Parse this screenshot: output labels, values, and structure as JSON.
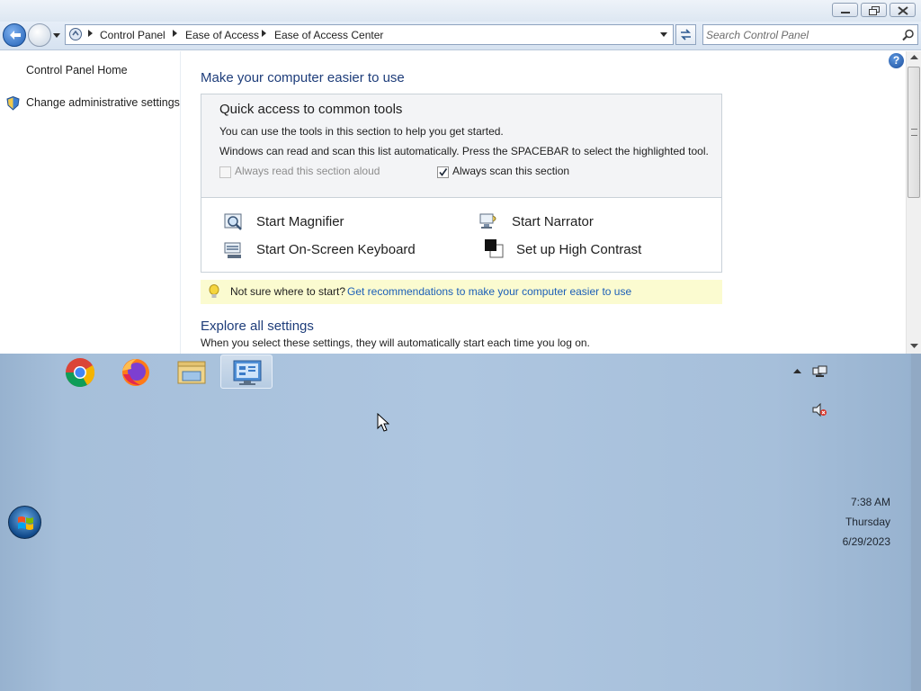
{
  "window": {
    "address_bar": {
      "breadcrumbs": [
        "Control Panel",
        "Ease of Access",
        "Ease of Access Center"
      ]
    },
    "search": {
      "placeholder": "Search Control Panel"
    }
  },
  "left_pane": {
    "links": [
      "Control Panel Home",
      "Change administrative settings"
    ]
  },
  "content": {
    "title": "Make your computer easier to use",
    "quick_access": {
      "title": "Quick access to common tools",
      "line1": "You can use the tools in this section to help you get started.",
      "line2": "Windows can read and scan this list automatically.  Press the SPACEBAR to select the highlighted tool.",
      "checkbox_read_aloud": {
        "label": "Always read this section aloud",
        "checked": false,
        "enabled": false
      },
      "checkbox_scan": {
        "label": "Always scan this section",
        "checked": true,
        "enabled": true
      },
      "tools": {
        "magnifier": "Start Magnifier",
        "narrator": "Start Narrator",
        "keyboard": "Start On-Screen Keyboard",
        "contrast": "Set up High Contrast"
      }
    },
    "tip": {
      "text": "Not sure where to start?",
      "link": "Get recommendations to make your computer easier to use"
    },
    "explore": {
      "title": "Explore all settings",
      "subtitle": "When you select these settings, they will automatically start each time you log on."
    }
  },
  "taskbar": {
    "pinned": [
      "chrome-icon",
      "firefox-icon",
      "file-explorer-icon",
      "control-panel-icon"
    ],
    "clock": {
      "time": "7:38 AM",
      "day": "Thursday",
      "date": "6/29/2023"
    }
  },
  "colors": {
    "link": "#1c5fb7",
    "heading": "#1e3d7a",
    "tip_background": "#fbfbd0",
    "desktop": "#a9c1dc"
  }
}
